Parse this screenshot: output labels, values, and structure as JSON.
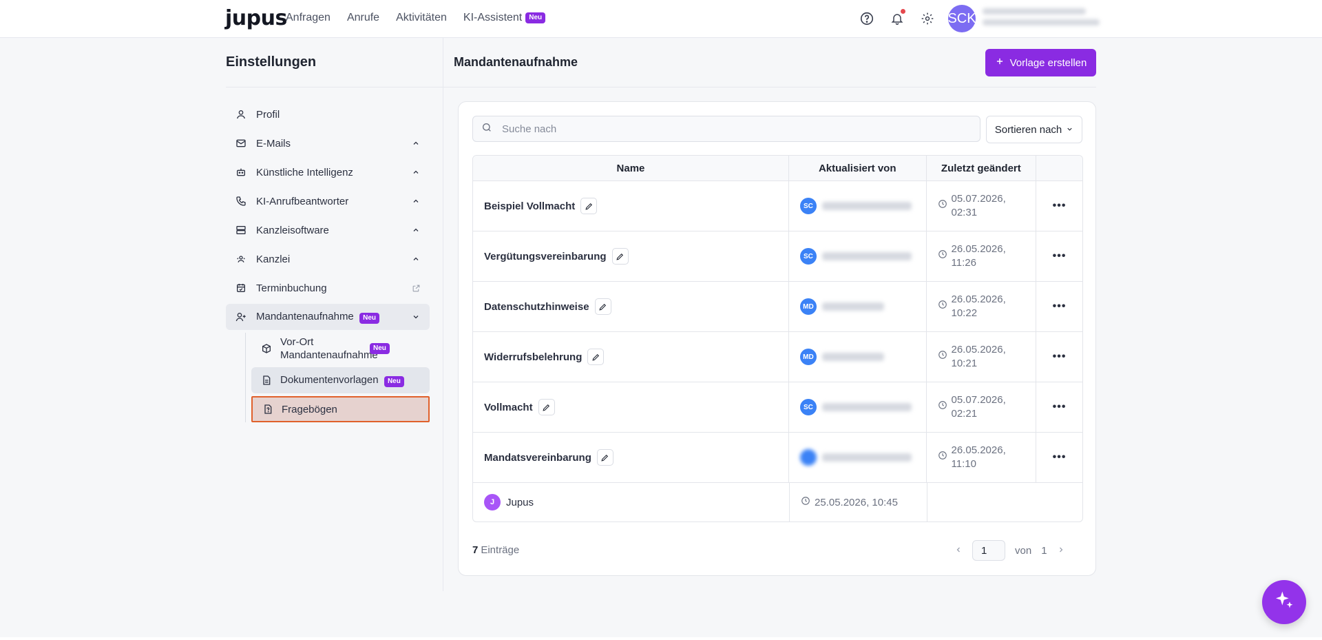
{
  "topbar": {
    "logo": "jupus",
    "nav": [
      {
        "label": "Anfragen"
      },
      {
        "label": "Anrufe"
      },
      {
        "label": "Aktivitäten"
      },
      {
        "label": "KI-Assistent",
        "badge": "Neu"
      }
    ],
    "avatar_initials": "SCK",
    "icons": [
      "help-circle-icon",
      "bell-icon",
      "gear-icon"
    ]
  },
  "sidebar": {
    "title": "Einstellungen",
    "items": [
      {
        "label": "Profil",
        "icon": "user-icon"
      },
      {
        "label": "E-Mails",
        "icon": "mail-icon"
      },
      {
        "label": "Künstliche Intelligenz",
        "icon": "robot-icon"
      },
      {
        "label": "KI-Anrufbeantworter",
        "icon": "phone-icon"
      },
      {
        "label": "Kanzleisoftware",
        "icon": "server-icon"
      },
      {
        "label": "Kanzlei",
        "icon": "team-icon"
      },
      {
        "label": "Terminbuchung",
        "icon": "calendar-check-icon"
      },
      {
        "label": "Mandantenaufnahme",
        "icon": "user-plus-icon",
        "badge": "Neu"
      }
    ],
    "sub_items": [
      {
        "label": "Vor-Ort Mandantenaufnahme",
        "badge": "Neu",
        "icon": "box-icon"
      },
      {
        "label": "Dokumentenvorlagen",
        "badge": "Neu",
        "icon": "document-icon"
      },
      {
        "label": "Fragebögen",
        "icon": "question-file-icon"
      }
    ]
  },
  "content": {
    "title": "Mandantenaufnahme",
    "create_button": "Vorlage erstellen",
    "search_placeholder": "Suche nach",
    "sort_label": "Sortieren nach",
    "columns": [
      "Name",
      "Aktualisiert von",
      "Zuletzt geändert"
    ],
    "rows": [
      {
        "name": "Beispiel Vollmacht",
        "updated_by": "SC",
        "date": "05.07.2026,",
        "time": "02:31"
      },
      {
        "name": "Vergütungsvereinbarung",
        "updated_by": "SC",
        "date": "26.05.2026,",
        "time": "11:26"
      },
      {
        "name": "Datenschutzhinweise",
        "updated_by": "MD",
        "date": "26.05.2026,",
        "time": "10:22"
      },
      {
        "name": "Widerrufsbelehrung",
        "updated_by": "MD",
        "date": "26.05.2026,",
        "time": "10:21"
      },
      {
        "name": "Vollmacht",
        "updated_by": "SC",
        "date": "05.07.2026,",
        "time": "02:21"
      },
      {
        "name": "Mandatsvereinbarung",
        "updated_by": "",
        "date": "26.05.2026,",
        "time": "11:10"
      }
    ],
    "last_row": {
      "avatar": "J",
      "name": "Jupus",
      "datetime": "25.05.2026, 10:45"
    },
    "count": "7",
    "count_label": "Einträge",
    "page": "1",
    "page_of": "von",
    "page_total": "1"
  },
  "colors": {
    "accent": "#8a2be2",
    "highlight_border": "#e0602b",
    "highlight_bg": "#e6d2cf"
  }
}
